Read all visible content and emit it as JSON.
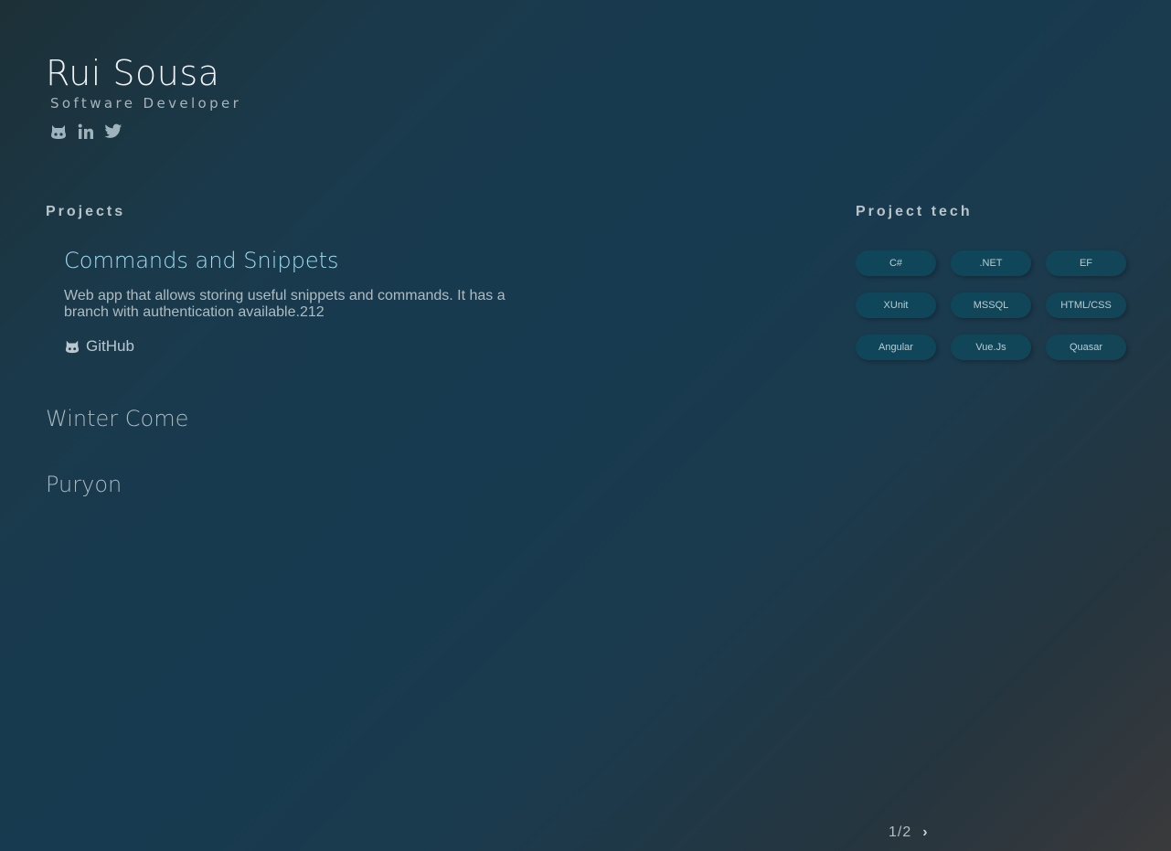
{
  "profile": {
    "name": "Rui Sousa",
    "role": "Software Developer",
    "socials": [
      {
        "icon": "github-icon"
      },
      {
        "icon": "linkedin-icon"
      },
      {
        "icon": "twitter-icon"
      }
    ]
  },
  "projects": {
    "title": "Projects",
    "active": {
      "name": "Commands and Snippets",
      "description": "Web app that allows storing useful snippets and commands. It has a branch with authentication available.212",
      "link_label": "GitHub"
    },
    "others": [
      "Winter Come",
      "Puryon"
    ]
  },
  "tech": {
    "title": "Project tech",
    "items": [
      "C#",
      ".NET",
      "EF",
      "XUnit",
      "MSSQL",
      "HTML/CSS",
      "Angular",
      "Vue.Js",
      "Quasar"
    ]
  },
  "pager": {
    "label": "1/2",
    "next_glyph": "›"
  },
  "colors": {
    "accent": "#9fdcf0",
    "chip_bg": "#0a5064"
  }
}
